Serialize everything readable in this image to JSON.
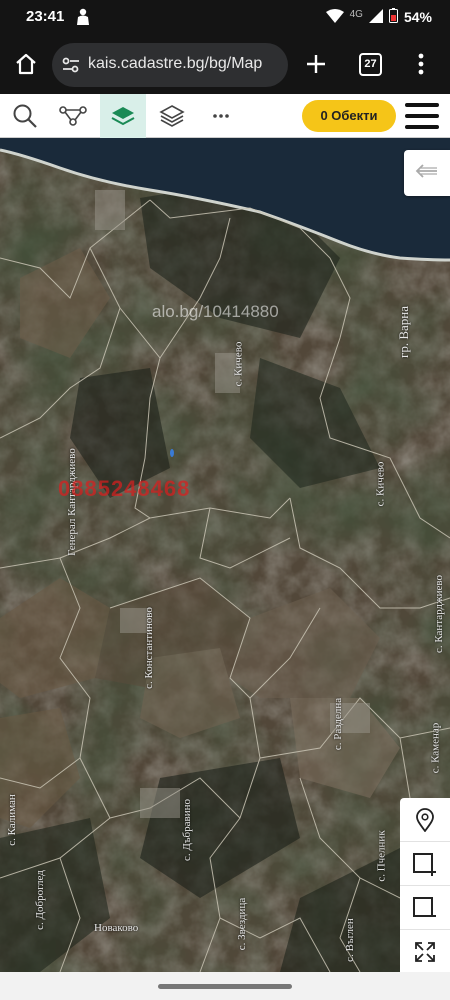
{
  "status_bar": {
    "time": "23:41",
    "network": "4G",
    "battery": "54%",
    "icons": [
      "person-notification-icon",
      "wifi-icon",
      "signal-icon",
      "battery-icon"
    ]
  },
  "browser": {
    "url": "kais.cadastre.bg/bg/Map",
    "tab_count": "27",
    "icons": [
      "home-icon",
      "site-settings-icon",
      "new-tab-icon",
      "tabs-icon",
      "menu-icon"
    ]
  },
  "toolbar": {
    "objects_label": "0 Обекти",
    "icons": [
      "search-icon",
      "route-icon",
      "layers-filled-icon",
      "layers-icon",
      "more-icon",
      "hamburger-icon"
    ]
  },
  "map": {
    "watermark": "alo.bg/10414880",
    "phone_watermark": "0885248468",
    "labels": [
      {
        "text": "гр. Варна",
        "angle": -90
      },
      {
        "text": "с. Кичево",
        "angle": -90
      },
      {
        "text": "Генерал Кантарджиево",
        "angle": -90
      },
      {
        "text": "с. Кичево",
        "angle": -90
      },
      {
        "text": "с. Константиново",
        "angle": -90
      },
      {
        "text": "с. Кантарджиево",
        "angle": -90
      },
      {
        "text": "с. Разделна",
        "angle": -90
      },
      {
        "text": "с. Каменар",
        "angle": -90
      },
      {
        "text": "с. Калиман",
        "angle": -90
      },
      {
        "text": "с. Дъбравино",
        "angle": -90
      },
      {
        "text": "с. Пчелник",
        "angle": -90
      },
      {
        "text": "с. Доброглед",
        "angle": -90
      },
      {
        "text": "с. Звездица",
        "angle": -90
      },
      {
        "text": "Новаково",
        "angle": 0
      },
      {
        "text": "с. Въглен",
        "angle": -90
      }
    ],
    "side_tools": [
      "location-pin-icon",
      "add-area-icon",
      "remove-area-icon",
      "expand-icon"
    ],
    "back_icon": "arrow-left-icon"
  }
}
